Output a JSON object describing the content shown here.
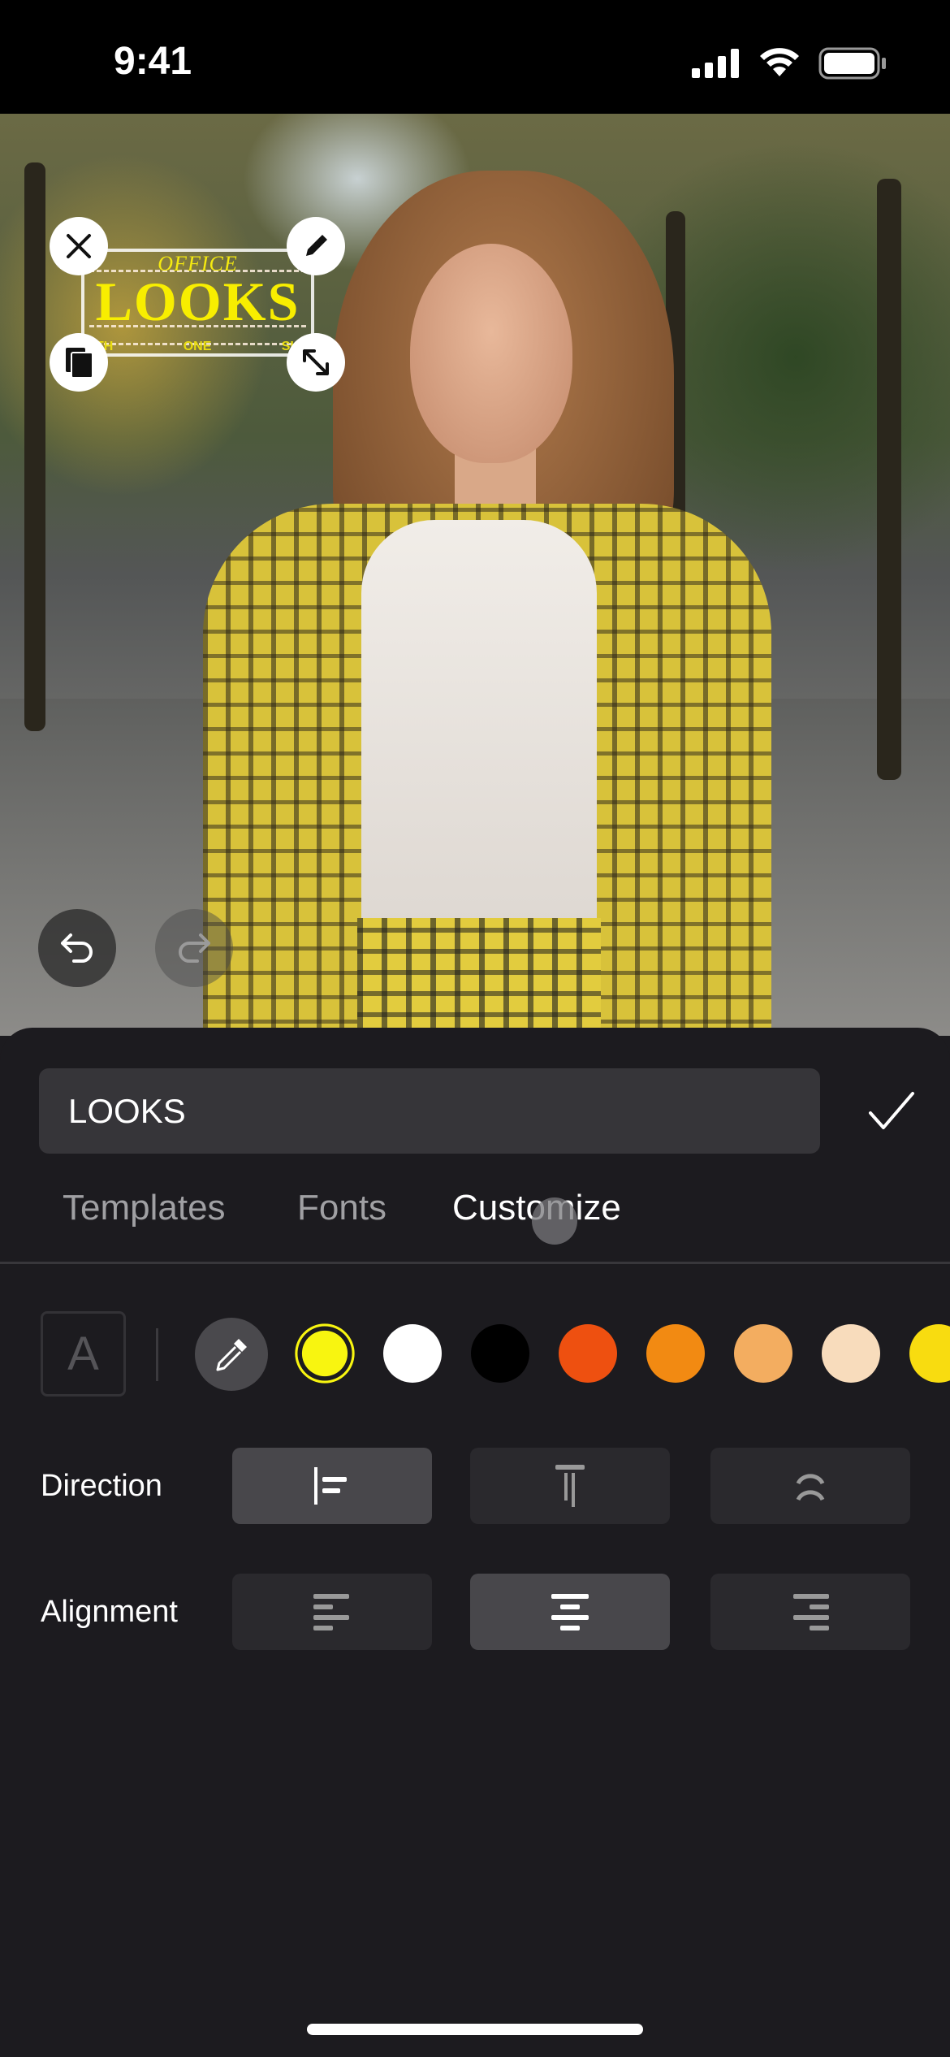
{
  "status_bar": {
    "time": "9:41",
    "icons": [
      "cellular-signal-icon",
      "wifi-icon",
      "battery-icon"
    ]
  },
  "canvas": {
    "sticker": {
      "top_text": "OFFICE",
      "main_text": "LOOKS",
      "bottom_words": [
        "TH",
        "ONE",
        "SH"
      ],
      "text_color": "#f8ee00"
    },
    "handles": [
      "close-icon",
      "pencil-icon",
      "duplicate-icon",
      "resize-icon"
    ],
    "undo_icon": "undo-icon",
    "redo_icon": "redo-icon"
  },
  "editor": {
    "text_value": "LOOKS",
    "confirm_icon": "checkmark-icon",
    "tabs": [
      {
        "label": "Templates",
        "active": false
      },
      {
        "label": "Fonts",
        "active": false
      },
      {
        "label": "Customize",
        "active": true
      }
    ],
    "font_style_glyph": "A",
    "colors": [
      "#f8f510",
      "#ffffff",
      "#000000",
      "#ee5010",
      "#f28a12",
      "#f3ad60",
      "#f8dcbc",
      "#f8dc10"
    ],
    "selected_color": "#f8f510",
    "direction": {
      "label": "Direction",
      "options": [
        "horizontal",
        "vertical",
        "curved"
      ],
      "selected": "horizontal"
    },
    "alignment": {
      "label": "Alignment",
      "options": [
        "left",
        "center",
        "right"
      ],
      "selected": "center"
    }
  }
}
